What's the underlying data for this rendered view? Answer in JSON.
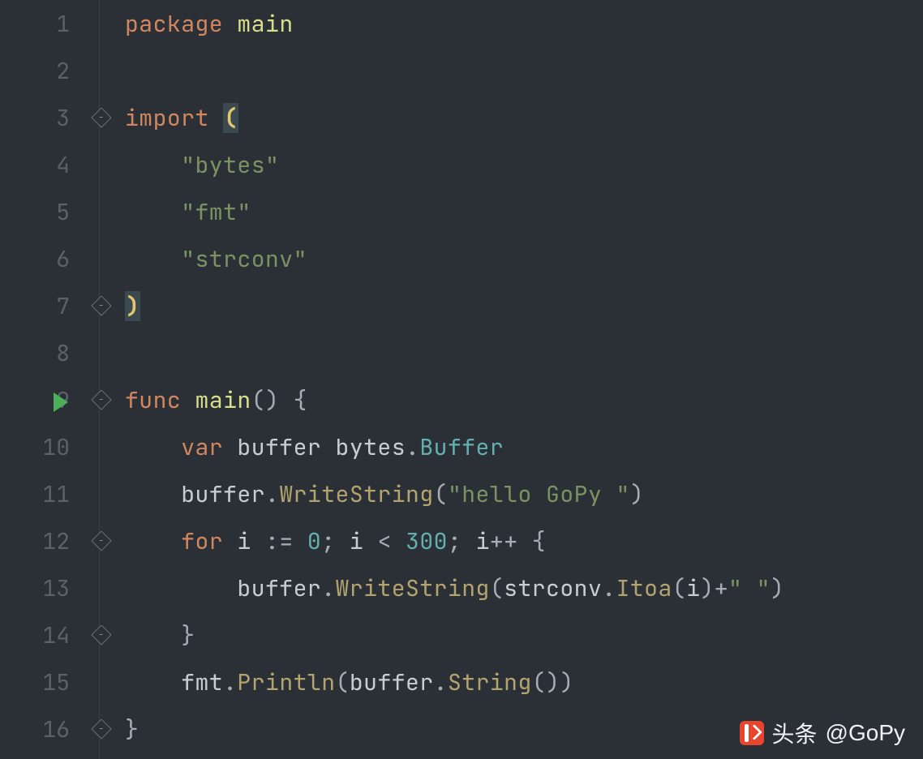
{
  "watermark": {
    "prefix": "头条",
    "handle": "@GoPy"
  },
  "lines": [
    {
      "num": "1",
      "fold": null,
      "runIcon": false,
      "tokens": [
        [
          "kw",
          "package"
        ],
        [
          "",
          " "
        ],
        [
          "pkg",
          "main"
        ]
      ]
    },
    {
      "num": "2",
      "fold": "line",
      "runIcon": false,
      "tokens": []
    },
    {
      "num": "3",
      "fold": "open",
      "runIcon": false,
      "tokens": [
        [
          "kw",
          "import"
        ],
        [
          "",
          ""
        ],
        [
          "",
          ""
        ],
        [
          "",
          ""
        ],
        [
          "",
          ""
        ],
        [
          "",
          ""
        ],
        [
          "",
          ""
        ],
        [
          "",
          ""
        ],
        [
          "",
          ""
        ],
        [
          "",
          ""
        ],
        [
          "",
          ""
        ],
        [
          "",
          ""
        ],
        [
          "",
          ""
        ],
        [
          "",
          ""
        ],
        [
          "",
          ""
        ],
        [
          "",
          ""
        ],
        [
          "",
          ""
        ],
        [
          "",
          ""
        ],
        [
          "",
          ""
        ],
        [
          "",
          ""
        ],
        [
          "",
          ""
        ],
        [
          "",
          ""
        ],
        [
          "",
          ""
        ],
        [
          "",
          ""
        ],
        [
          "",
          ""
        ],
        [
          "",
          ""
        ],
        [
          "",
          ""
        ],
        [
          "",
          ""
        ],
        [
          "",
          ""
        ],
        [
          "",
          ""
        ],
        [
          "",
          ""
        ]
      ]
    },
    {
      "num": "4",
      "fold": "line",
      "runIcon": false,
      "tokens": [
        [
          "",
          "    "
        ],
        [
          "str",
          "\"bytes\""
        ]
      ]
    },
    {
      "num": "5",
      "fold": "line",
      "runIcon": false,
      "tokens": [
        [
          "",
          "    "
        ],
        [
          "str",
          "\"fmt\""
        ]
      ]
    },
    {
      "num": "6",
      "fold": "line",
      "runIcon": false,
      "tokens": [
        [
          "",
          "    "
        ],
        [
          "str",
          "\"strconv\""
        ]
      ]
    },
    {
      "num": "7",
      "fold": "close",
      "runIcon": false,
      "tokens": []
    },
    {
      "num": "8",
      "fold": null,
      "runIcon": false,
      "tokens": []
    },
    {
      "num": "9",
      "fold": "open",
      "runIcon": true,
      "tokens": [
        [
          "kw",
          "func"
        ],
        [
          "",
          ""
        ],
        [
          "",
          ""
        ],
        [
          "",
          ""
        ],
        [
          "",
          ""
        ],
        [
          "",
          ""
        ],
        [
          "",
          ""
        ],
        [
          "",
          ""
        ],
        [
          "",
          ""
        ],
        [
          "",
          ""
        ],
        [
          "",
          ""
        ],
        [
          "",
          ""
        ],
        [
          "",
          ""
        ],
        [
          "",
          ""
        ],
        [
          "",
          ""
        ],
        [
          "",
          ""
        ],
        [
          "",
          ""
        ],
        [
          "",
          ""
        ],
        [
          "",
          ""
        ],
        [
          "",
          ""
        ],
        [
          "",
          ""
        ],
        [
          "",
          ""
        ],
        [
          "",
          ""
        ],
        [
          "",
          ""
        ]
      ]
    },
    {
      "num": "10",
      "fold": "line",
      "runIcon": false,
      "tokens": [
        [
          "",
          "    "
        ],
        [
          "kw",
          "var"
        ],
        [
          "",
          ""
        ],
        [
          "ident",
          " buffer "
        ],
        [
          "ident",
          "bytes"
        ],
        [
          "pale",
          "."
        ],
        [
          "type",
          "Buffer"
        ]
      ]
    },
    {
      "num": "11",
      "fold": "line",
      "runIcon": false,
      "tokens": [
        [
          "",
          "    "
        ],
        [
          "ident",
          "buffer"
        ],
        [
          "pale",
          "."
        ],
        [
          "method",
          "WriteString"
        ],
        [
          "pale",
          "("
        ],
        [
          "str",
          "\"hello GoPy \""
        ],
        [
          "pale",
          ")"
        ]
      ]
    },
    {
      "num": "12",
      "fold": "open",
      "runIcon": false,
      "tokens": [
        [
          "",
          "    "
        ],
        [
          "kw",
          "for"
        ],
        [
          "ident",
          " i "
        ],
        [
          "pale",
          ":= "
        ],
        [
          "num",
          "0"
        ],
        [
          "pale",
          "; "
        ],
        [
          "ident",
          "i "
        ],
        [
          "pale",
          "< "
        ],
        [
          "num",
          "300"
        ],
        [
          "pale",
          "; "
        ],
        [
          "ident",
          "i"
        ],
        [
          "pale",
          "++ {"
        ]
      ]
    },
    {
      "num": "13",
      "fold": "line",
      "runIcon": false,
      "tokens": [
        [
          "",
          "        "
        ],
        [
          "ident",
          "buffer"
        ],
        [
          "pale",
          "."
        ],
        [
          "method",
          "WriteString"
        ],
        [
          "pale",
          "("
        ],
        [
          "ident",
          "strconv"
        ],
        [
          "pale",
          "."
        ],
        [
          "method",
          "Itoa"
        ],
        [
          "pale",
          "("
        ],
        [
          "ident",
          "i"
        ],
        [
          "pale",
          ")+"
        ],
        [
          "str",
          "\" \""
        ],
        [
          "pale",
          ")"
        ]
      ]
    },
    {
      "num": "14",
      "fold": "close",
      "runIcon": false,
      "tokens": [
        [
          "",
          "    "
        ],
        [
          "pale",
          "}"
        ]
      ]
    },
    {
      "num": "15",
      "fold": "line",
      "runIcon": false,
      "tokens": [
        [
          "",
          "    "
        ],
        [
          "ident",
          "fmt"
        ],
        [
          "pale",
          "."
        ],
        [
          "method",
          "Println"
        ],
        [
          "pale",
          "("
        ],
        [
          "ident",
          "buffer"
        ],
        [
          "pale",
          "."
        ],
        [
          "method",
          "String"
        ],
        [
          "pale",
          "())"
        ]
      ]
    },
    {
      "num": "16",
      "fold": "close",
      "runIcon": false,
      "tokens": [
        [
          "pale",
          "}"
        ]
      ]
    }
  ],
  "special": {
    "line3_import": "import ",
    "line3_open": "(",
    "line7_close": ")",
    "line9": {
      "func": "func",
      "sp": " ",
      "main": "main",
      "parens": "()",
      "sp2": " ",
      "brace": "{"
    }
  }
}
